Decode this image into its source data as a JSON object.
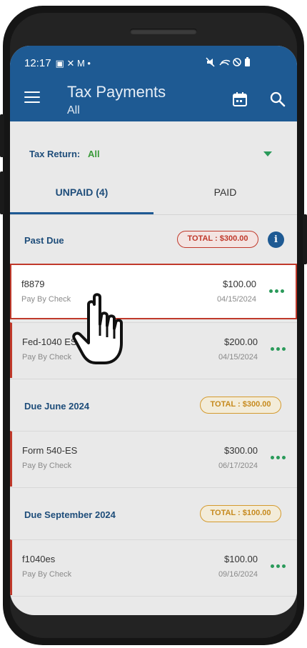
{
  "status_bar": {
    "time": "12:17"
  },
  "header": {
    "title": "Tax Payments",
    "subtitle": "All"
  },
  "filter": {
    "label": "Tax Return:",
    "value": "All"
  },
  "tabs": [
    {
      "label": "UNPAID (4)"
    },
    {
      "label": "PAID"
    }
  ],
  "sections": [
    {
      "title": "Past Due",
      "total": "TOTAL : $300.00",
      "rows": [
        {
          "name": "f8879",
          "method": "Pay By Check",
          "amount": "$100.00",
          "date": "04/15/2024"
        },
        {
          "name": "Fed-1040 ES",
          "method": "Pay By Check",
          "amount": "$200.00",
          "date": "04/15/2024"
        }
      ]
    },
    {
      "title": "Due June 2024",
      "total": "TOTAL : $300.00",
      "rows": [
        {
          "name": "Form 540-ES",
          "method": "Pay By Check",
          "amount": "$300.00",
          "date": "06/17/2024"
        }
      ]
    },
    {
      "title": "Due September 2024",
      "total": "TOTAL : $100.00",
      "rows": [
        {
          "name": "f1040es",
          "method": "Pay By Check",
          "amount": "$100.00",
          "date": "09/16/2024"
        }
      ]
    }
  ],
  "colors": {
    "appbar": "#1e5a93",
    "past_due": "#c0392b",
    "upcoming": "#d49a2e",
    "more_dots": "#2a9a5a"
  },
  "icons": [
    "menu-icon",
    "calendar-icon",
    "search-icon",
    "info-icon",
    "more-options-icon",
    "hand-pointer-icon"
  ]
}
